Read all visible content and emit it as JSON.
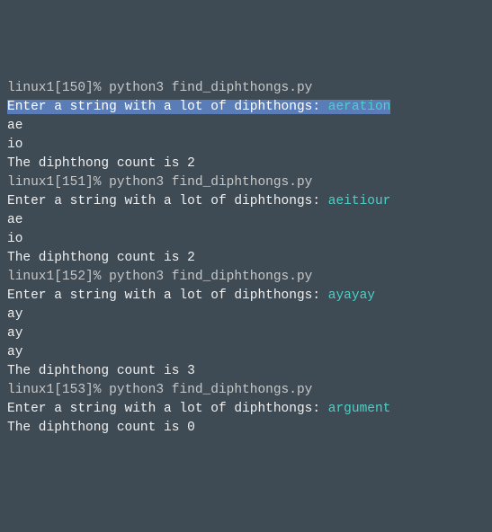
{
  "runs": [
    {
      "history": 150,
      "prompt_host": "linux1",
      "command": "python3 find_diphthongs.py",
      "input_prompt": "Enter a string with a lot of diphthongs: ",
      "user_input": "aeration",
      "selected": true,
      "outputs": [
        "ae",
        "io"
      ],
      "count_line": "The diphthong count is 2"
    },
    {
      "history": 151,
      "prompt_host": "linux1",
      "command": "python3 find_diphthongs.py",
      "input_prompt": "Enter a string with a lot of diphthongs: ",
      "user_input": "aeitiour",
      "selected": false,
      "outputs": [
        "ae",
        "io"
      ],
      "count_line": "The diphthong count is 2"
    },
    {
      "history": 152,
      "prompt_host": "linux1",
      "command": "python3 find_diphthongs.py",
      "input_prompt": "Enter a string with a lot of diphthongs: ",
      "user_input": "ayayay",
      "selected": false,
      "outputs": [
        "ay",
        "ay",
        "ay"
      ],
      "count_line": "The diphthong count is 3"
    },
    {
      "history": 153,
      "prompt_host": "linux1",
      "command": "python3 find_diphthongs.py",
      "input_prompt": "Enter a string with a lot of diphthongs: ",
      "user_input": "argument",
      "selected": false,
      "outputs": [],
      "count_line": "The diphthong count is 0"
    }
  ]
}
